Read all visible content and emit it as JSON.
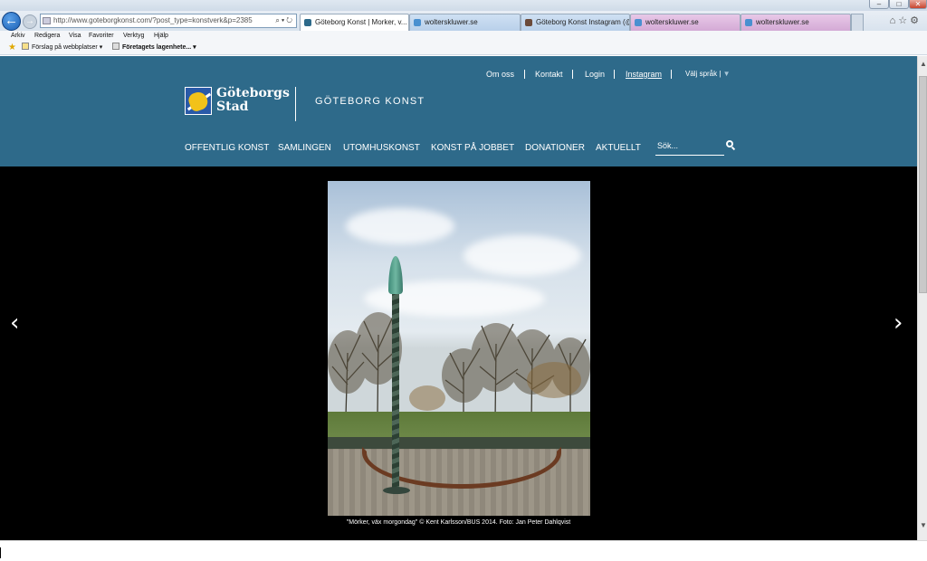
{
  "browser": {
    "address": "http://www.goteborgkonst.com/?post_type=konstverk&p=2385",
    "tabs": [
      {
        "label": "Göteborg Konst | Morker, v...",
        "state": "active",
        "color": "#ffffff"
      },
      {
        "label": "wolterskluwer.se",
        "state": "inactive",
        "color": "#c6dbf1"
      },
      {
        "label": "Göteborg Konst Instagram (@...",
        "state": "inactive",
        "color": "#c6dbf1"
      },
      {
        "label": "wolterskluwer.se",
        "state": "inactive",
        "color": "#dcb8de"
      },
      {
        "label": "wolterskluwer.se",
        "state": "inactive",
        "color": "#dcb8de"
      }
    ],
    "menu": [
      "Arkiv",
      "Redigera",
      "Visa",
      "Favoriter",
      "Verktyg",
      "Hjälp"
    ],
    "favorites": [
      {
        "label": "Förslag på webbplatser ▾"
      },
      {
        "label": "Företagets lagenhete... ▾"
      }
    ]
  },
  "site": {
    "topnav": [
      "Om oss",
      "Kontakt",
      "Login",
      "Instagram",
      "Välj språk |"
    ],
    "topnav_arrow": "▼",
    "logo": {
      "line1": "Göteborgs",
      "line2": "Stad"
    },
    "title": "GÖTEBORG KONST",
    "mainnav": [
      "OFFENTLIG KONST",
      "SAMLINGEN",
      "UTOMHUSKONST",
      "KONST PÅ JOBBET",
      "DONATIONER",
      "AKTUELLT"
    ],
    "search": {
      "placeholder": "Sök..."
    },
    "accent": "#2e6a8a"
  },
  "gallery": {
    "caption": "\"Mörker, väx morgondag\" © Kent Karlsson/BUS 2014. Foto: Jan Peter Dahlqvist",
    "prev": "‹",
    "next": "›"
  }
}
